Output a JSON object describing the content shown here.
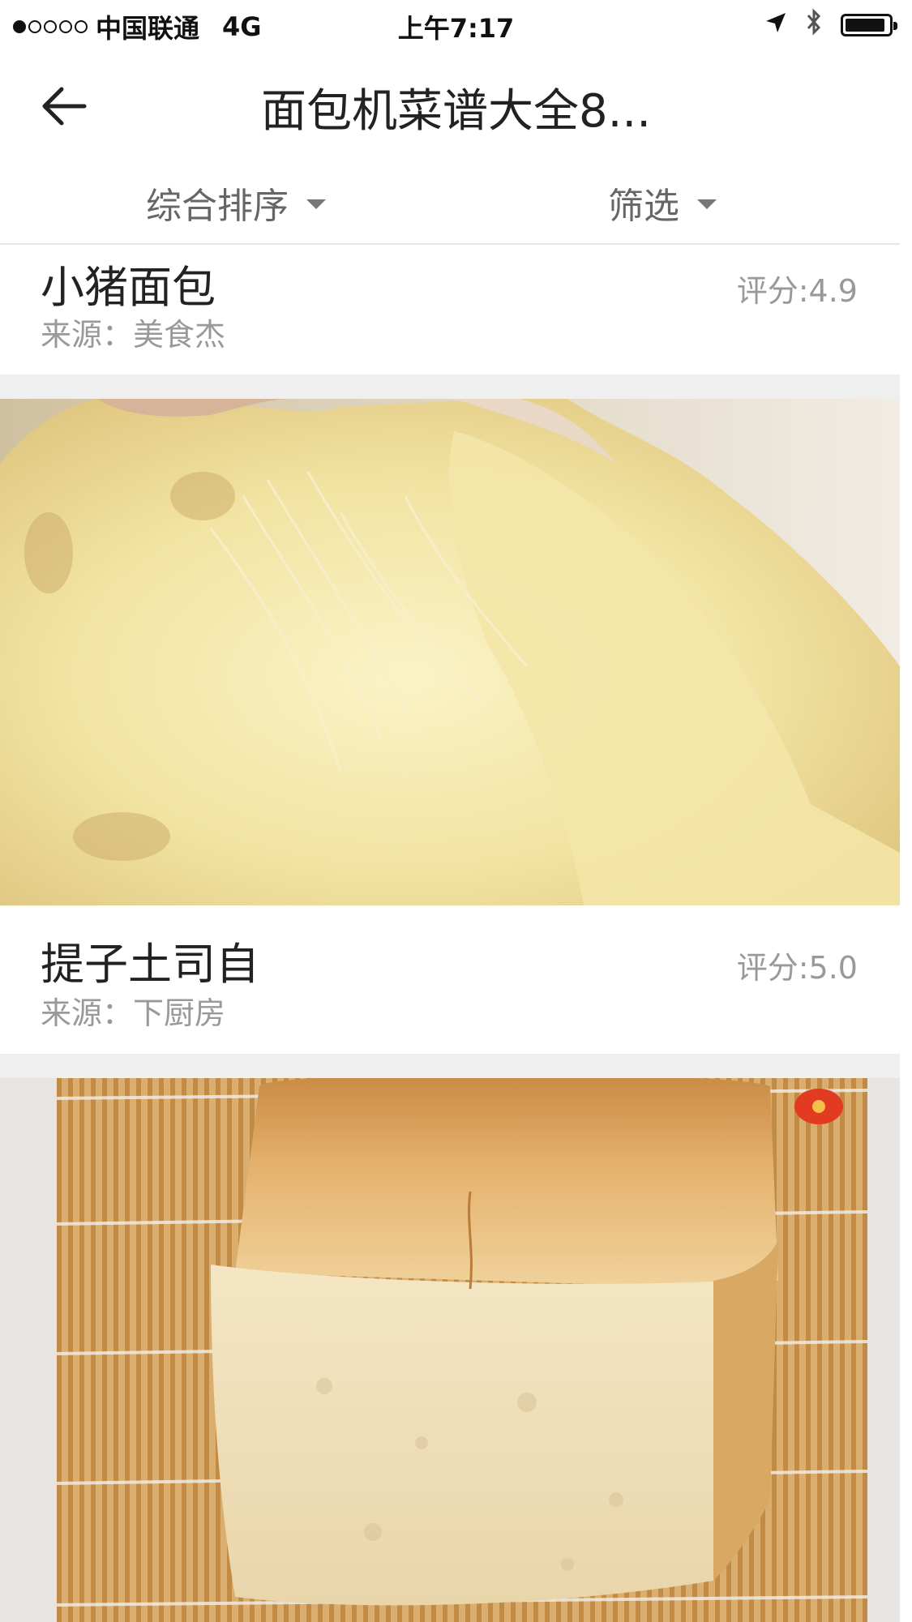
{
  "status_bar": {
    "carrier": "中国联通",
    "network": "4G",
    "time": "上午7:17",
    "signal_dots_filled": 1,
    "signal_dots_total": 5,
    "battery_level": 0.9,
    "icons": [
      "location-arrow-icon",
      "bluetooth-icon",
      "battery-icon"
    ]
  },
  "header": {
    "title": "面包机菜谱大全8...",
    "back_icon": "back-arrow-icon"
  },
  "filters": {
    "sort_label": "综合排序",
    "filter_label": "筛选"
  },
  "recipes": [
    {
      "title": "小猪面包",
      "source": "来源：美食杰",
      "rating": "评分:4.9"
    },
    {
      "title": "提子土司自",
      "source": "来源：下厨房",
      "rating": "评分:5.0"
    }
  ],
  "colors": {
    "divider": "#efefef",
    "text_primary": "#222222",
    "text_secondary": "#999999"
  }
}
